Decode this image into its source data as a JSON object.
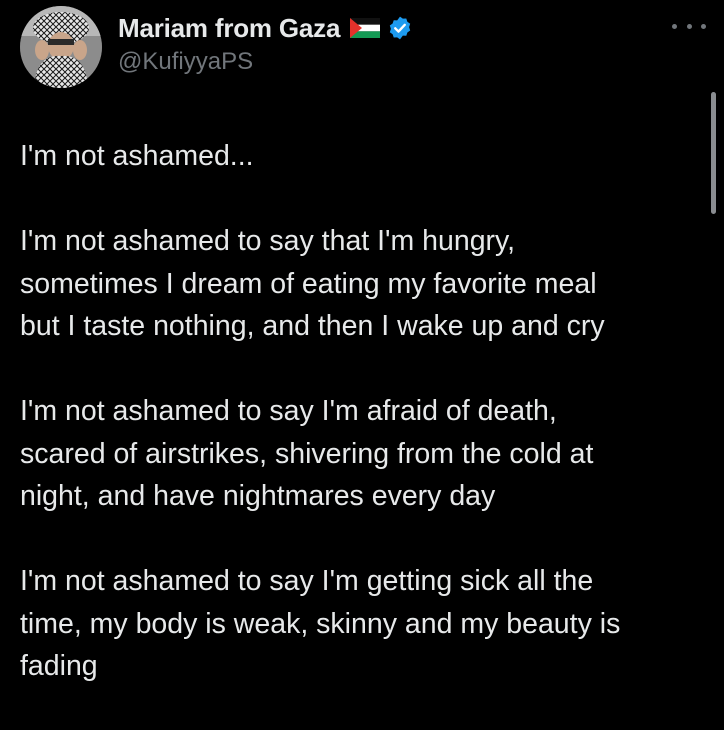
{
  "author": {
    "display_name": "Mariam from Gaza",
    "handle": "@KufiyyaPS",
    "flag_icon": "palestine-flag-icon",
    "verified_icon": "verified-badge-icon",
    "verified_color": "#1d9bf0"
  },
  "menu": {
    "icon": "more-horizontal-icon"
  },
  "tweet": {
    "paragraphs": [
      {
        "lines": [
          "I'm not ashamed..."
        ]
      },
      {
        "lines": [
          "I'm not ashamed to say that I'm hungry,",
          "sometimes I dream of eating my favorite meal",
          "but I taste nothing, and then I wake up and cry"
        ]
      },
      {
        "lines": [
          "I'm not ashamed to say I'm afraid of death,",
          "scared of airstrikes, shivering from the cold at",
          "night, and have nightmares every day"
        ]
      },
      {
        "lines": [
          "I'm not ashamed to say I'm getting sick all the",
          "time, my body is weak, skinny and my beauty is",
          "fading"
        ]
      }
    ]
  },
  "colors": {
    "background": "#000000",
    "primary_text": "#e7e9ea",
    "secondary_text": "#71767b"
  }
}
